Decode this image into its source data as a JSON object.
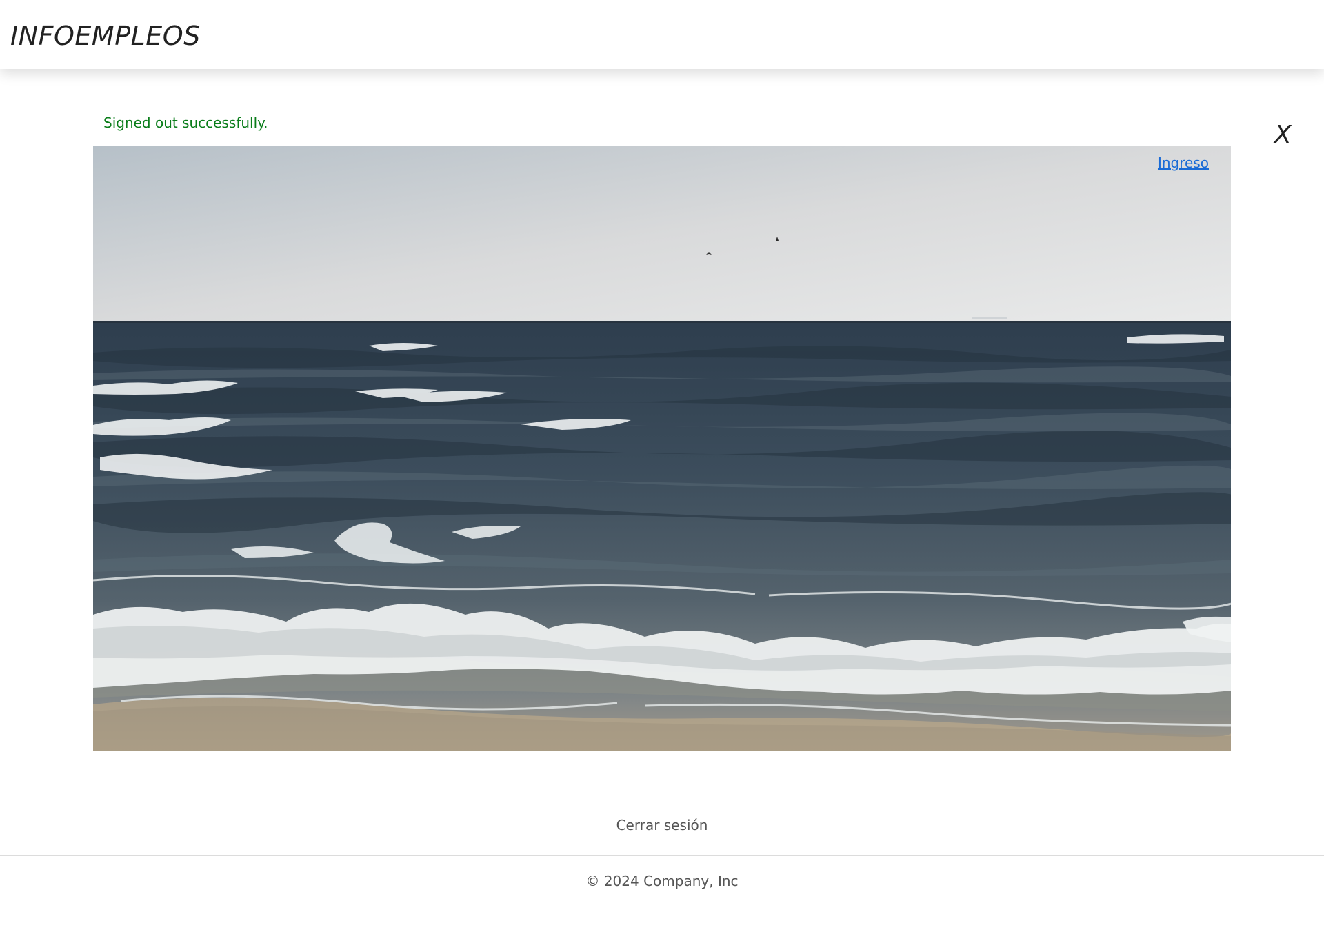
{
  "header": {
    "brand": "INFOEMPLEOS"
  },
  "flash": {
    "message": "Signed out successfully."
  },
  "dismiss": {
    "label": "X"
  },
  "hero": {
    "login_label": "Ingreso"
  },
  "actions": {
    "logout_label": "Cerrar sesión"
  },
  "footer": {
    "copyright": "© 2024 Company, Inc"
  },
  "colors": {
    "flash_text": "#0a7d1a",
    "link": "#1a6bd6",
    "brand_text": "#222222"
  }
}
